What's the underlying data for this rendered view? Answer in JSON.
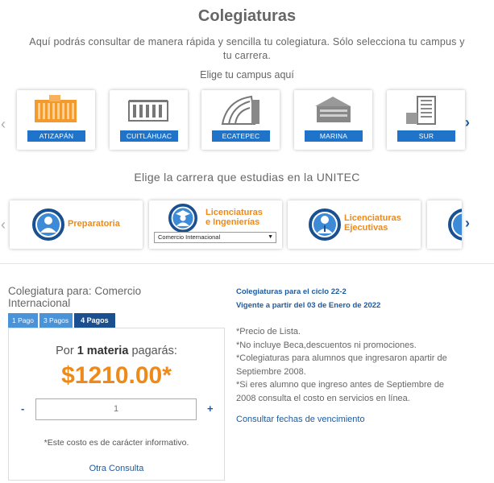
{
  "page": {
    "title": "Colegiaturas",
    "intro": "Aquí podrás consultar de manera rápida y sencilla tu colegiatura. Sólo selecciona tu campus y tu carrera.",
    "campus_heading": "Elige tu campus aquí",
    "career_heading": "Elige la carrera que estudias en la UNITEC"
  },
  "campuses": [
    {
      "label": "ATIZAPÁN",
      "color": "#f29a2e"
    },
    {
      "label": "CUITLÁHUAC",
      "color": "#7a7a7a"
    },
    {
      "label": "ECATEPEC",
      "color": "#7a7a7a"
    },
    {
      "label": "MARINA",
      "color": "#7a7a7a"
    },
    {
      "label": "SUR",
      "color": "#7a7a7a"
    }
  ],
  "careers": [
    {
      "name": "Preparatoria"
    },
    {
      "name_line1": "Licenciaturas",
      "name_line2": "e Ingenierías",
      "selected": "Comercio Internacional"
    },
    {
      "name_line1": "Licenciaturas",
      "name_line2": "Ejecutivas"
    }
  ],
  "arrows": {
    "left": "‹",
    "right": "›"
  },
  "quote": {
    "title": "Colegiatura para: Comercio Internacional",
    "tabs": [
      "1 Pago",
      "3 Pagos",
      "4 Pagos"
    ],
    "active_tab": "4 Pagos",
    "label_pre": "Por",
    "label_bold": "1 materia",
    "label_post": "pagarás:",
    "price": "$1210.00*",
    "minus": "-",
    "plus": "+",
    "quantity": "1",
    "note": "*Este costo es de carácter informativo.",
    "again": "Otra Consulta"
  },
  "info": {
    "cycle": "Colegiaturas para el ciclo 22-2",
    "valid": "Vigente a partir del 03 de Enero de 2022",
    "notes": [
      "*Precio de Lista.",
      "*No incluye Beca,descuentos ni promociones.",
      "*Colegiaturas para alumnos que ingresaron apartir de Septiembre 2008.",
      "*Si eres alumno que ingreso antes de Septiembre de 2008 consulta el costo en servicios en línea."
    ],
    "link": "Consultar fechas de vencimiento"
  },
  "colors": {
    "brand_blue": "#1e5a9c",
    "label_blue": "#1f73c9",
    "accent_orange": "#ee8a1a"
  }
}
